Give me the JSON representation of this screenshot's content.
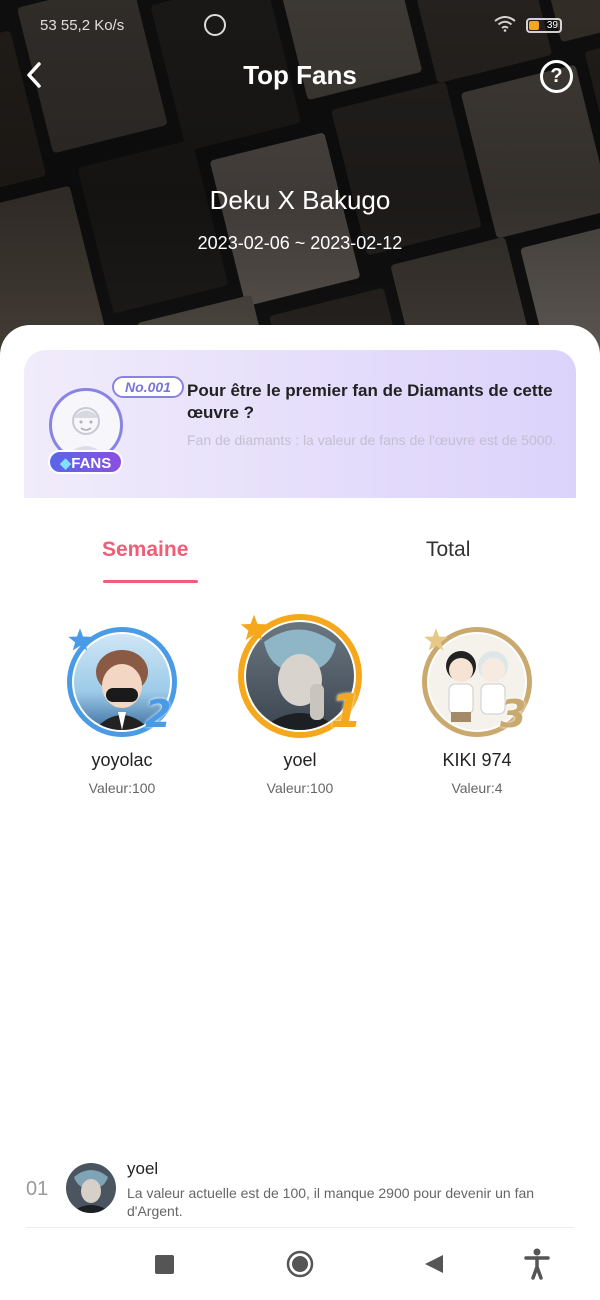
{
  "status_bar": {
    "speed": "53   55,2 Ko/s",
    "battery": "39"
  },
  "header": {
    "title": "Top Fans",
    "help_label": "?"
  },
  "work": {
    "title": "Deku X Bakugo",
    "date_range": "2023-02-06 ~ 2023-02-12"
  },
  "promo": {
    "number": "No.001",
    "badge": "FANS",
    "heading": "Pour être le premier fan de Diamants de cette œuvre ?",
    "subtext": "Fan de diamants : la valeur de fans de l'œuvre est de 5000."
  },
  "tabs": [
    {
      "label": "Semaine",
      "active": true
    },
    {
      "label": "Total",
      "active": false
    }
  ],
  "podium": [
    {
      "rank": "2",
      "name": "yoyolac",
      "value": "Valeur:100",
      "ring_color": "#4a9be6"
    },
    {
      "rank": "1",
      "name": "yoel",
      "value": "Valeur:100",
      "ring_color": "#f5a81c"
    },
    {
      "rank": "3",
      "name": "KIKI 974",
      "value": "Valeur:4",
      "ring_color": "#c9a96e"
    }
  ],
  "list": [
    {
      "position": "01",
      "name": "yoel",
      "message": "La valeur actuelle est de 100, il manque 2900 pour devenir un fan d'Argent."
    }
  ],
  "colors": {
    "accent": "#ee5e77",
    "promo_purple": "#8a83e6",
    "badge_blue": "#5a66e8"
  },
  "icons": {
    "back": "chevron-left-icon",
    "help": "question-circle-icon",
    "nav": [
      "square-stop-icon",
      "circle-home-icon",
      "triangle-back-icon",
      "accessibility-icon"
    ]
  }
}
